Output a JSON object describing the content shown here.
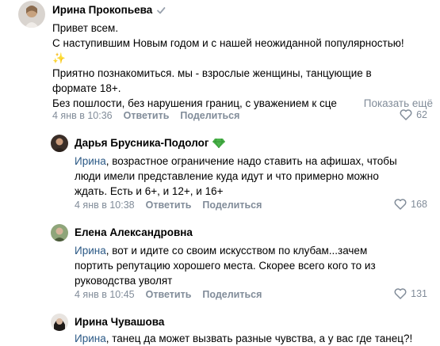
{
  "comments": [
    {
      "author": "Ирина Прокопьева",
      "lines": [
        "Привет всем.",
        "С наступившим Новым годом и с нашей неожиданной популярностью!",
        "✨",
        "Приятно познакомиться. мы - взрослые женщины, танцующие в",
        "формате 18+.",
        "Без пошлости, без нарушения границ, с уважением к сце"
      ],
      "show_more": "Показать ещё",
      "time": "4 янв в 10:36",
      "reply": "Ответить",
      "share": "Поделиться",
      "likes": "62"
    },
    {
      "author": "Дарья Брусника-Подолог",
      "mention": "Ирина",
      "lines": [
        ", возрастное ограничение надо ставить на афишах, чтобы",
        "люди имели представление куда идут и что примерно можно",
        "ждать. Есть и 6+, и 12+, и 16+"
      ],
      "time": "4 янв в 10:38",
      "reply": "Ответить",
      "share": "Поделиться",
      "likes": "168"
    },
    {
      "author": "Елена Александровна",
      "mention": "Ирина",
      "lines": [
        ", вот и идите со своим искусством по клубам...зачем",
        "портить репутацию хорошего места. Скорее всего кого то из",
        "руководства уволят"
      ],
      "time": "4 янв в 10:45",
      "reply": "Ответить",
      "share": "Поделиться",
      "likes": "131"
    },
    {
      "author": "Ирина Чувашова",
      "mention": "Ирина",
      "lines": [
        ", танец да может вызвать разные чувства, а у вас где танец?!"
      ]
    }
  ],
  "colors": {
    "link": "#2a5885",
    "meta": "#818c99",
    "verified": "#99a2ad",
    "badge_green": "#4bb34b"
  }
}
